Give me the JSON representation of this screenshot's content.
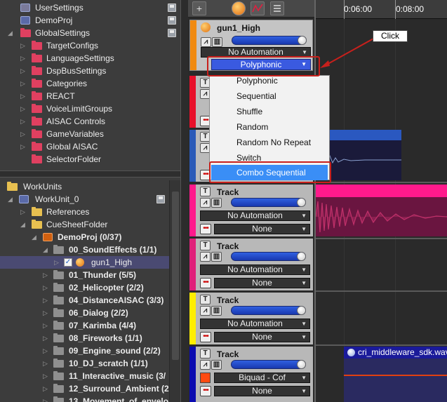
{
  "top_tree": {
    "items": [
      {
        "label": "UserSettings",
        "icon": "settings-doc-icon"
      },
      {
        "label": "DemoProj",
        "icon": "project-icon"
      },
      {
        "label": "GlobalSettings",
        "icon": "folder-icon"
      },
      {
        "label": "TargetConfigs",
        "icon": "folder-icon"
      },
      {
        "label": "LanguageSettings",
        "icon": "folder-icon"
      },
      {
        "label": "DspBusSettings",
        "icon": "folder-icon"
      },
      {
        "label": "Categories",
        "icon": "folder-icon"
      },
      {
        "label": "REACT",
        "icon": "folder-icon"
      },
      {
        "label": "VoiceLimitGroups",
        "icon": "folder-icon"
      },
      {
        "label": "AISAC Controls",
        "icon": "folder-icon"
      },
      {
        "label": "GameVariables",
        "icon": "folder-icon"
      },
      {
        "label": "Global AISAC",
        "icon": "folder-icon"
      },
      {
        "label": "SelectorFolder",
        "icon": "folder-icon"
      }
    ]
  },
  "bottom_tree": {
    "items": [
      {
        "label": "WorkUnits"
      },
      {
        "label": "WorkUnit_0"
      },
      {
        "label": "References"
      },
      {
        "label": "CueSheetFolder"
      },
      {
        "label": "DemoProj  (0/37)"
      },
      {
        "label": "00_SoundEffects  (1/1)"
      },
      {
        "label": "gun1_High"
      },
      {
        "label": "01_Thunder  (5/5)"
      },
      {
        "label": "02_Helicopter  (2/2)"
      },
      {
        "label": "04_DistanceAISAC  (3/3)"
      },
      {
        "label": "06_Dialog  (2/2)"
      },
      {
        "label": "07_Karimba  (4/4)"
      },
      {
        "label": "08_Fireworks  (1/1)"
      },
      {
        "label": "09_Engine_sound  (2/2)"
      },
      {
        "label": "10_DJ_scratch  (1/1)"
      },
      {
        "label": "11_Interactive_music  (3/"
      },
      {
        "label": "12_Surround_Ambient  (2"
      },
      {
        "label": "13_Movement_of_envelo"
      }
    ]
  },
  "toolbar": {
    "add": "+"
  },
  "ruler": {
    "ticks": [
      "0:06:00",
      "0:08:00"
    ]
  },
  "cue": {
    "name": "gun1_High",
    "automation": "No Automation",
    "type_value": "Polyphonic"
  },
  "tracks": [
    {
      "name": "Track",
      "automation": "No Automation",
      "extra": "None",
      "color": "#ff1a8c"
    },
    {
      "name": "Track",
      "automation": "No Automation",
      "extra": "None",
      "color": "#e0207a"
    },
    {
      "name": "Track",
      "automation": "No Automation",
      "extra": "None",
      "color": "#ffee00"
    },
    {
      "name": "Track",
      "automation": "Biquad - Cof",
      "extra": "None",
      "color": "#0b0bb0"
    }
  ],
  "popup": {
    "options": [
      "Polyphonic",
      "Sequential",
      "Shuffle",
      "Random",
      "Random No Repeat",
      "Switch",
      "Combo Sequential"
    ],
    "highlighted": "Combo Sequential"
  },
  "annotation": {
    "label": "Click"
  },
  "waveform_clip": {
    "label": "cri_middleware_sdk.wav"
  },
  "colors": {
    "accent": "#3a8ef6",
    "callout": "#c8201c"
  }
}
